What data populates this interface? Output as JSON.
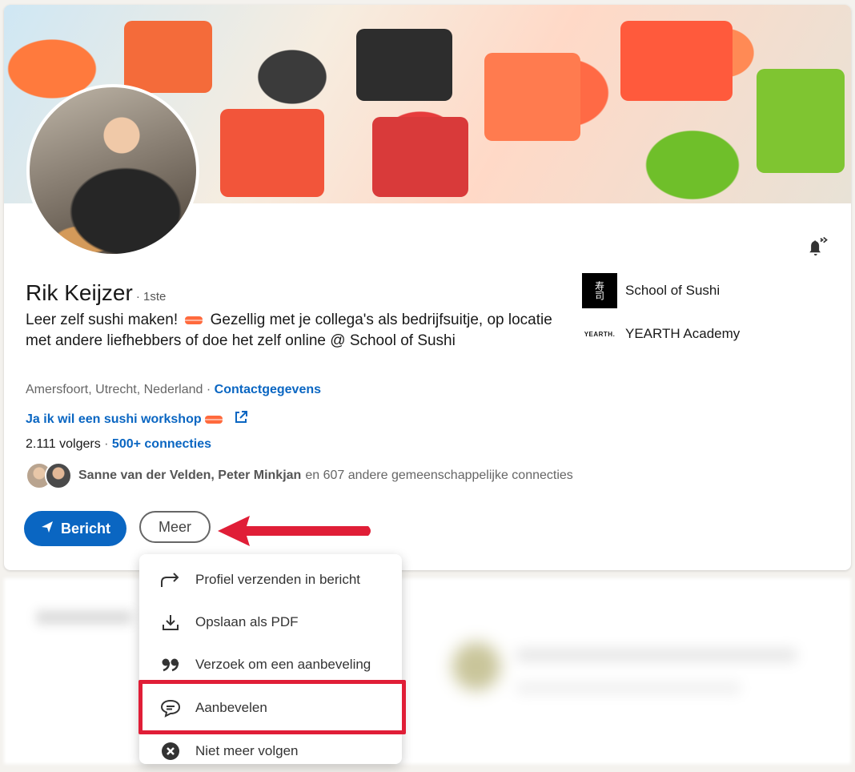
{
  "profile": {
    "name": "Rik Keijzer",
    "degree": "· 1ste",
    "headline_part1": "Leer zelf sushi maken!",
    "headline_part2": "Gezellig met je collega's als bedrijfsuitje, op locatie met andere liefhebbers of doe het zelf online @ School of Sushi",
    "location": "Amersfoort, Utrecht, Nederland ·",
    "contact_link": "Contactgegevens",
    "website_label": "Ja ik wil een sushi workshop",
    "followers": "2.111 volgers",
    "followers_sep": "·",
    "connections": "500+ connecties",
    "mutual_names": "Sanne van der Velden, Peter Minkjan",
    "mutual_rest": "en 607 andere gemeenschappelijke connecties"
  },
  "companies": [
    {
      "name": "School of Sushi",
      "logo_text": "寿司"
    },
    {
      "name": "YEARTH Academy",
      "logo_text": "YEARTH."
    }
  ],
  "actions": {
    "message_label": "Bericht",
    "more_label": "Meer"
  },
  "menu": {
    "items": [
      {
        "label": "Profiel verzenden in bericht",
        "icon": "share-arrow-icon"
      },
      {
        "label": "Opslaan als PDF",
        "icon": "download-icon"
      },
      {
        "label": "Verzoek om een aanbeveling",
        "icon": "quote-icon"
      },
      {
        "label": "Aanbevelen",
        "icon": "speech-bubble-icon"
      },
      {
        "label": "Niet meer volgen",
        "icon": "close-circle-icon"
      }
    ]
  },
  "colors": {
    "accent": "#0a66c2",
    "annotation_red": "#e01e37"
  }
}
